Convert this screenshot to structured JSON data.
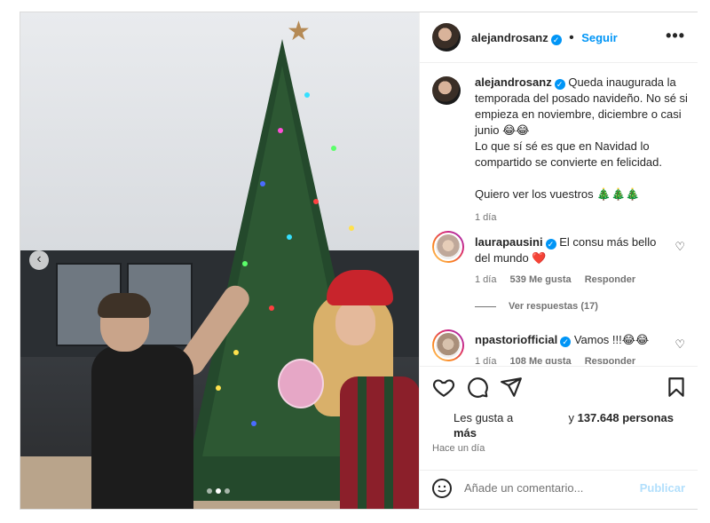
{
  "post": {
    "author": "alejandrosanz",
    "follow_label": "Seguir",
    "more_label": "•••",
    "caption": "Queda inaugurada la temporada del posado navideño. No sé si empieza en noviembre, diciembre o casi junio 😂😂\nLo que sí sé es que en Navidad lo compartido se convierte en felicidad.\n\nQuiero ver los vuestros 🎄🎄🎄",
    "caption_time": "1 día",
    "media": {
      "carousel_prev": "‹",
      "slide_count": 3,
      "active_slide": 2
    }
  },
  "comments": [
    {
      "user": "laurapausini",
      "text": "El consu más bello del mundo ❤️",
      "time": "1 día",
      "likes": "539 Me gusta",
      "reply": "Responder",
      "view_replies": "Ver respuestas (17)"
    },
    {
      "user": "npastoriofficial",
      "text": "Vamos !!!😂😂",
      "time": "1 día",
      "likes": "108 Me gusta",
      "reply": "Responder"
    }
  ],
  "likes_line": {
    "prefix": "Les gusta a",
    "middle": "y",
    "count": "137.648 personas",
    "more": "más"
  },
  "posted_ago": "Hace un día",
  "add_comment": {
    "placeholder": "Añade un comentario...",
    "publish": "Publicar"
  },
  "colors": {
    "accent": "#0095f6",
    "text": "#262626",
    "muted": "#737373",
    "publish_disabled": "#b2dffc"
  }
}
